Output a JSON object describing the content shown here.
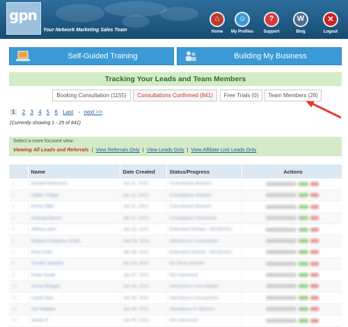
{
  "header": {
    "logo_text": "gpn",
    "tagline": "Your Network Marketing Sales Team",
    "nav": [
      {
        "label": "Home",
        "icon": "home-icon"
      },
      {
        "label": "My Profiles",
        "icon": "profile-icon"
      },
      {
        "label": "Support",
        "icon": "support-icon"
      },
      {
        "label": "Blog",
        "icon": "wordpress-icon"
      },
      {
        "label": "Logout",
        "icon": "logout-icon"
      }
    ]
  },
  "buttons": {
    "left": {
      "label": "Self-Guided Training",
      "icon": "laptop-icon"
    },
    "right": {
      "label": "Building My Business",
      "icon": "people-icon"
    }
  },
  "tracking": {
    "title": "Tracking Your Leads and Team Members"
  },
  "tabs": [
    {
      "label": "Booking Consultation (1155)",
      "active": false
    },
    {
      "label": "Consultations Confirmed (841)",
      "active": true
    },
    {
      "label": "Free Trials (0)",
      "active": false
    },
    {
      "label": "Team Members (28)",
      "active": false
    }
  ],
  "pagination": {
    "pages": [
      "1",
      "2",
      "3",
      "4",
      "5",
      "6"
    ],
    "current": "1",
    "last_label": "Last",
    "next_label": "next >>",
    "info": "(Currently showing 1 - 25 of 841)"
  },
  "focus": {
    "title": "Select a more focused view:",
    "active_view": "Viewing All Leads and Referrals",
    "links": [
      "View Referrals Only",
      "View Leads Only",
      "View Affiliate Link Leads Only"
    ]
  },
  "table": {
    "columns": [
      "",
      "Name",
      "Date Created",
      "Status/Progress",
      "Actions"
    ],
    "rows": [
      {
        "num": "1",
        "name": "Donald Robertson",
        "date": "Jan 11, 2021",
        "status": "Consultation Booked"
      },
      {
        "num": "2",
        "name": "Callen Thayer",
        "date": "Jan 11, 2021",
        "status": "Consultation Booked"
      },
      {
        "num": "3",
        "name": "Emmy Mills",
        "date": "Jan 11, 2021",
        "status": "Consultation Booked"
      },
      {
        "num": "4",
        "name": "Amanda Buron",
        "date": "Jan 11, 2021",
        "status": "Consultation Rebooked"
      },
      {
        "num": "5",
        "name": "Jeffrey Lane",
        "date": "Jan 10, 2021",
        "status": "Estimated Started - 09/18/2021"
      },
      {
        "num": "6",
        "name": "Radaria Ferbanns Smith",
        "date": "Feb 09, 2021",
        "status": "Attendance Consultation"
      },
      {
        "num": "7",
        "name": "Rene Kate",
        "date": "Jan 09, 2021",
        "status": "Estimated Started - 09/18/2021"
      },
      {
        "num": "8",
        "name": "Timothi Jawelon",
        "date": "Jan 09, 2021",
        "status": "No Show booked"
      },
      {
        "num": "9",
        "name": "Frank Smith",
        "date": "Jan 07, 2021",
        "status": "Not Interested"
      },
      {
        "num": "10",
        "name": "Jenna Morgan",
        "date": "Jan 06, 2021",
        "status": "Attendance Consultation"
      },
      {
        "num": "11",
        "name": "Loyde Dae",
        "date": "Jan 06, 2021",
        "status": "Attendance Consultation"
      },
      {
        "num": "12",
        "name": "Joe Wallace",
        "date": "Jan 05, 2021",
        "status": "Attendance In Session"
      },
      {
        "num": "13",
        "name": "Jackie P.",
        "date": "Jan 05, 2021",
        "status": "Not Interested"
      }
    ]
  },
  "colors": {
    "header_bg": "#1e5a84",
    "button_blue": "#3b9ad6",
    "green_bar": "#d5ebc7",
    "active_red": "#c0392b",
    "arrow_red": "#e53935"
  }
}
